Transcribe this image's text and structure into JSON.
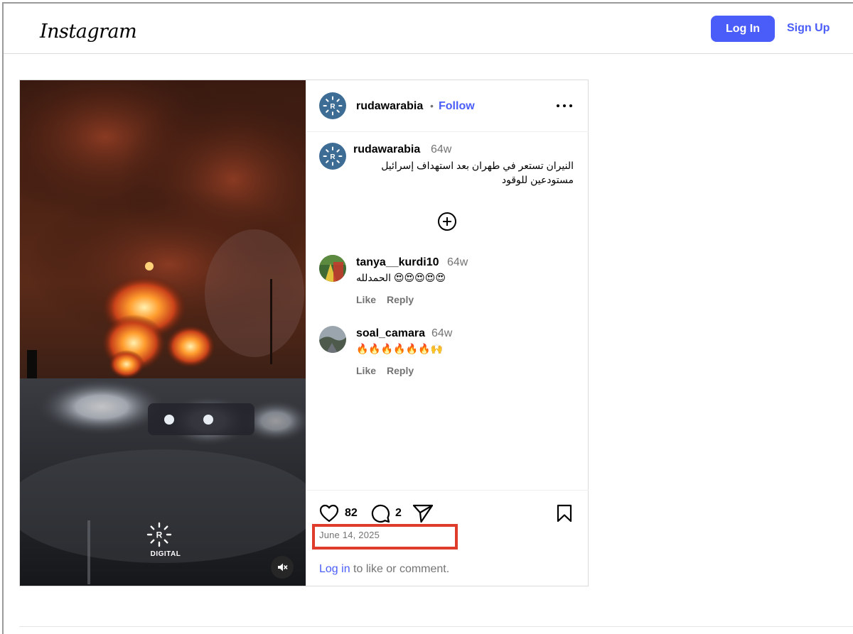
{
  "header": {
    "logo": "Instagram",
    "login_label": "Log In",
    "signup_label": "Sign Up"
  },
  "post": {
    "author": "rudawarabia",
    "separator": "•",
    "follow_label": "Follow",
    "caption": {
      "user": "rudawarabia",
      "time": "64w",
      "text": "النيران تستعر في طهران بعد استهداف إسرائيل مستودعين للوقود"
    },
    "comments": [
      {
        "user": "tanya__kurdi10",
        "time": "64w",
        "text": "الحمدلله 😍😍😍😍😍",
        "like_label": "Like",
        "reply_label": "Reply"
      },
      {
        "user": "soal_camara",
        "time": "64w",
        "text": "🔥🔥🔥🔥🔥🔥🙌",
        "like_label": "Like",
        "reply_label": "Reply"
      }
    ],
    "likes_count": "82",
    "comments_count": "2",
    "date": "June 14, 2025",
    "login_prompt_link": "Log in",
    "login_prompt_rest": " to like or comment.",
    "watermark_text": "DIGITAL",
    "watermark_letter": "R"
  },
  "colors": {
    "accent": "#4a5df9",
    "highlight": "#e03c2b",
    "avatar": "#3d6c95"
  }
}
